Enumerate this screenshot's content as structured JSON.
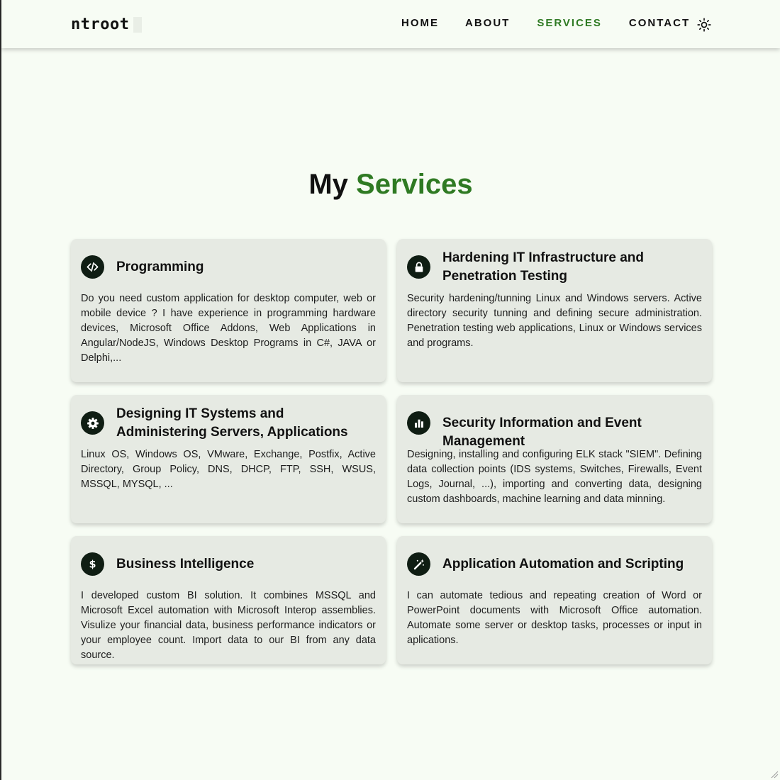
{
  "nav": {
    "logo": "ntroot",
    "links": [
      {
        "label": "HOME",
        "active": false
      },
      {
        "label": "ABOUT",
        "active": false
      },
      {
        "label": "SERVICES",
        "active": true
      },
      {
        "label": "CONTACT",
        "active": false
      }
    ],
    "theme_toggle_icon": "sun-icon"
  },
  "section": {
    "title_prefix": "My",
    "title_accent": "Services"
  },
  "services": [
    {
      "icon": "code-icon",
      "title": "Programming",
      "description": "Do you need custom application for desktop computer, web or mobile device ? I have experience in programming hardware devices, Microsoft Office Addons, Web Applications in Angular/NodeJS, Windows Desktop Programs in C#, JAVA or Delphi,..."
    },
    {
      "icon": "lock-icon",
      "title": "Hardening IT Infrastructure and Penetration Testing",
      "description": "Security hardening/tunning Linux and Windows servers. Active directory security tunning and defining secure administration. Penetration testing web applications, Linux or Windows services and programs."
    },
    {
      "icon": "gear-icon",
      "title": "Designing IT Systems and Administering Servers, Applications",
      "description": "Linux OS, Windows OS, VMware, Exchange, Postfix, Active Directory, Group Policy, DNS, DHCP, FTP, SSH, WSUS, MSSQL, MYSQL, ..."
    },
    {
      "icon": "bar-chart-icon",
      "title": "Security Information and Event Management",
      "description": "Designing, installing and configuring ELK stack \"SIEM\". Defining data collection points (IDS systems, Switches, Firewalls, Event Logs, Journal, ...), importing and converting data, designing custom dashboards, machine learning and data minning."
    },
    {
      "icon": "dollar-icon",
      "title": "Business Intelligence",
      "description": "I developed custom BI solution. It combines MSSQL and Microsoft Excel automation with Microsoft Interop assemblies. Visulize your financial data, business performance indicators or your employee count. Import data to our BI from any data source."
    },
    {
      "icon": "magic-wand-icon",
      "title": "Application Automation and Scripting",
      "description": "I can automate tedious and repeating creation of Word or PowerPoint documents with Microsoft Office automation. Automate some server or desktop tasks, processes or input in aplications."
    }
  ],
  "colors": {
    "accent": "#2f7a23",
    "background": "#f7fcf4",
    "card": "#e6eae3",
    "icon_bg": "#0f1d13"
  }
}
